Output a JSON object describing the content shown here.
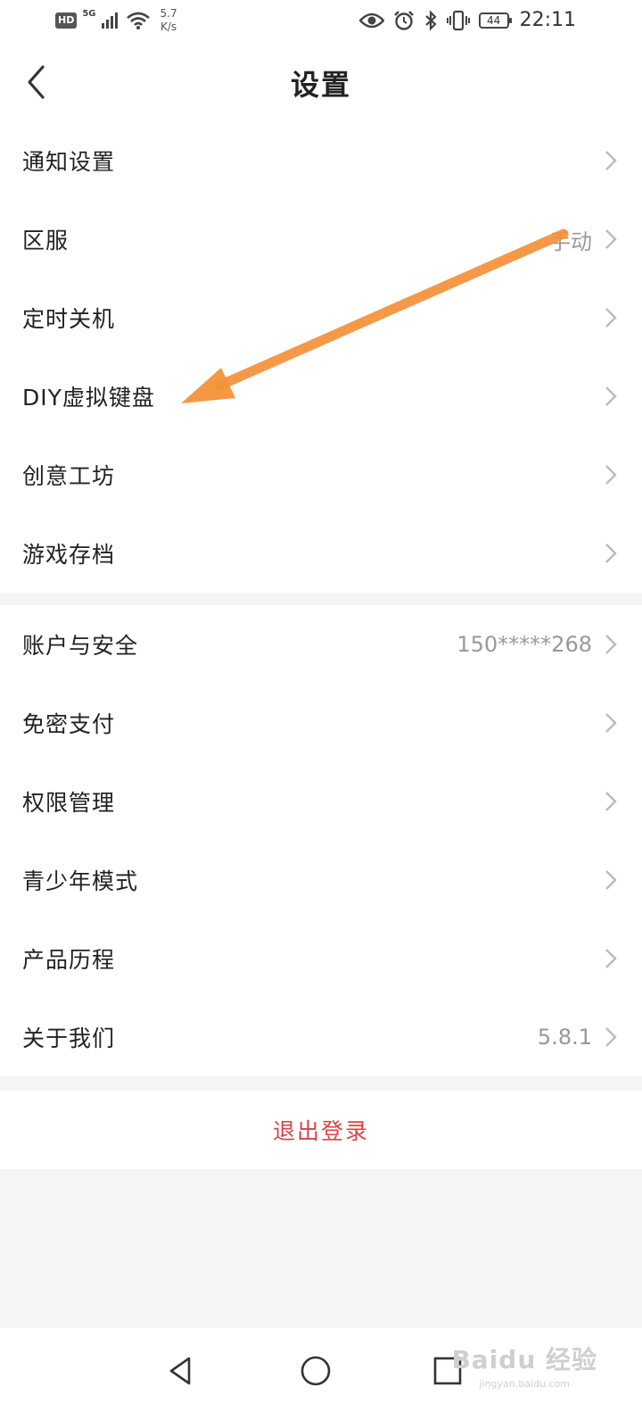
{
  "status_bar": {
    "hd_label": "HD",
    "network_label": "5G",
    "speed_value": "5.7",
    "speed_unit": "K/s",
    "battery_level": "44",
    "time": "22:11",
    "icons": [
      "hd-icon",
      "signal-icon",
      "wifi-icon",
      "eye-icon",
      "alarm-icon",
      "bluetooth-icon",
      "vibrate-icon",
      "battery-icon"
    ]
  },
  "header": {
    "title": "设置",
    "back_icon": "chevron-left-icon"
  },
  "group1": {
    "items": [
      {
        "label": "通知设置",
        "value": ""
      },
      {
        "label": "区服",
        "value": "手动"
      },
      {
        "label": "定时关机",
        "value": ""
      },
      {
        "label": "DIY虚拟键盘",
        "value": ""
      },
      {
        "label": "创意工坊",
        "value": ""
      },
      {
        "label": "游戏存档",
        "value": ""
      }
    ]
  },
  "group2": {
    "items": [
      {
        "label": "账户与安全",
        "value": "150*****268"
      },
      {
        "label": "免密支付",
        "value": ""
      },
      {
        "label": "权限管理",
        "value": ""
      },
      {
        "label": "青少年模式",
        "value": ""
      },
      {
        "label": "产品历程",
        "value": ""
      },
      {
        "label": "关于我们",
        "value": "5.8.1"
      }
    ]
  },
  "logout": {
    "label": "退出登录"
  },
  "nav_bar": {
    "icons": [
      "back-triangle-icon",
      "home-circle-icon",
      "recents-square-icon"
    ]
  },
  "watermark": {
    "main": "Baidu 经验",
    "sub": "jingyan.baidu.com"
  },
  "colors": {
    "accent_red": "#d64545",
    "annotation_arrow": "#f5913a",
    "background": "#f4f5f7"
  }
}
